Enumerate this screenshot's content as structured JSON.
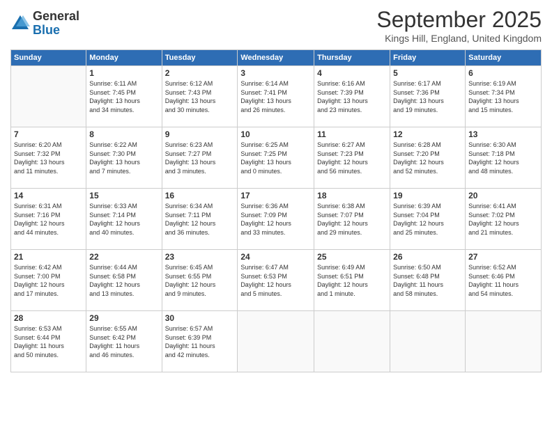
{
  "header": {
    "logo_general": "General",
    "logo_blue": "Blue",
    "month_title": "September 2025",
    "location": "Kings Hill, England, United Kingdom"
  },
  "days_of_week": [
    "Sunday",
    "Monday",
    "Tuesday",
    "Wednesday",
    "Thursday",
    "Friday",
    "Saturday"
  ],
  "weeks": [
    [
      {
        "day": "",
        "info": ""
      },
      {
        "day": "1",
        "info": "Sunrise: 6:11 AM\nSunset: 7:45 PM\nDaylight: 13 hours\nand 34 minutes."
      },
      {
        "day": "2",
        "info": "Sunrise: 6:12 AM\nSunset: 7:43 PM\nDaylight: 13 hours\nand 30 minutes."
      },
      {
        "day": "3",
        "info": "Sunrise: 6:14 AM\nSunset: 7:41 PM\nDaylight: 13 hours\nand 26 minutes."
      },
      {
        "day": "4",
        "info": "Sunrise: 6:16 AM\nSunset: 7:39 PM\nDaylight: 13 hours\nand 23 minutes."
      },
      {
        "day": "5",
        "info": "Sunrise: 6:17 AM\nSunset: 7:36 PM\nDaylight: 13 hours\nand 19 minutes."
      },
      {
        "day": "6",
        "info": "Sunrise: 6:19 AM\nSunset: 7:34 PM\nDaylight: 13 hours\nand 15 minutes."
      }
    ],
    [
      {
        "day": "7",
        "info": "Sunrise: 6:20 AM\nSunset: 7:32 PM\nDaylight: 13 hours\nand 11 minutes."
      },
      {
        "day": "8",
        "info": "Sunrise: 6:22 AM\nSunset: 7:30 PM\nDaylight: 13 hours\nand 7 minutes."
      },
      {
        "day": "9",
        "info": "Sunrise: 6:23 AM\nSunset: 7:27 PM\nDaylight: 13 hours\nand 3 minutes."
      },
      {
        "day": "10",
        "info": "Sunrise: 6:25 AM\nSunset: 7:25 PM\nDaylight: 13 hours\nand 0 minutes."
      },
      {
        "day": "11",
        "info": "Sunrise: 6:27 AM\nSunset: 7:23 PM\nDaylight: 12 hours\nand 56 minutes."
      },
      {
        "day": "12",
        "info": "Sunrise: 6:28 AM\nSunset: 7:20 PM\nDaylight: 12 hours\nand 52 minutes."
      },
      {
        "day": "13",
        "info": "Sunrise: 6:30 AM\nSunset: 7:18 PM\nDaylight: 12 hours\nand 48 minutes."
      }
    ],
    [
      {
        "day": "14",
        "info": "Sunrise: 6:31 AM\nSunset: 7:16 PM\nDaylight: 12 hours\nand 44 minutes."
      },
      {
        "day": "15",
        "info": "Sunrise: 6:33 AM\nSunset: 7:14 PM\nDaylight: 12 hours\nand 40 minutes."
      },
      {
        "day": "16",
        "info": "Sunrise: 6:34 AM\nSunset: 7:11 PM\nDaylight: 12 hours\nand 36 minutes."
      },
      {
        "day": "17",
        "info": "Sunrise: 6:36 AM\nSunset: 7:09 PM\nDaylight: 12 hours\nand 33 minutes."
      },
      {
        "day": "18",
        "info": "Sunrise: 6:38 AM\nSunset: 7:07 PM\nDaylight: 12 hours\nand 29 minutes."
      },
      {
        "day": "19",
        "info": "Sunrise: 6:39 AM\nSunset: 7:04 PM\nDaylight: 12 hours\nand 25 minutes."
      },
      {
        "day": "20",
        "info": "Sunrise: 6:41 AM\nSunset: 7:02 PM\nDaylight: 12 hours\nand 21 minutes."
      }
    ],
    [
      {
        "day": "21",
        "info": "Sunrise: 6:42 AM\nSunset: 7:00 PM\nDaylight: 12 hours\nand 17 minutes."
      },
      {
        "day": "22",
        "info": "Sunrise: 6:44 AM\nSunset: 6:58 PM\nDaylight: 12 hours\nand 13 minutes."
      },
      {
        "day": "23",
        "info": "Sunrise: 6:45 AM\nSunset: 6:55 PM\nDaylight: 12 hours\nand 9 minutes."
      },
      {
        "day": "24",
        "info": "Sunrise: 6:47 AM\nSunset: 6:53 PM\nDaylight: 12 hours\nand 5 minutes."
      },
      {
        "day": "25",
        "info": "Sunrise: 6:49 AM\nSunset: 6:51 PM\nDaylight: 12 hours\nand 1 minute."
      },
      {
        "day": "26",
        "info": "Sunrise: 6:50 AM\nSunset: 6:48 PM\nDaylight: 11 hours\nand 58 minutes."
      },
      {
        "day": "27",
        "info": "Sunrise: 6:52 AM\nSunset: 6:46 PM\nDaylight: 11 hours\nand 54 minutes."
      }
    ],
    [
      {
        "day": "28",
        "info": "Sunrise: 6:53 AM\nSunset: 6:44 PM\nDaylight: 11 hours\nand 50 minutes."
      },
      {
        "day": "29",
        "info": "Sunrise: 6:55 AM\nSunset: 6:42 PM\nDaylight: 11 hours\nand 46 minutes."
      },
      {
        "day": "30",
        "info": "Sunrise: 6:57 AM\nSunset: 6:39 PM\nDaylight: 11 hours\nand 42 minutes."
      },
      {
        "day": "",
        "info": ""
      },
      {
        "day": "",
        "info": ""
      },
      {
        "day": "",
        "info": ""
      },
      {
        "day": "",
        "info": ""
      }
    ]
  ]
}
